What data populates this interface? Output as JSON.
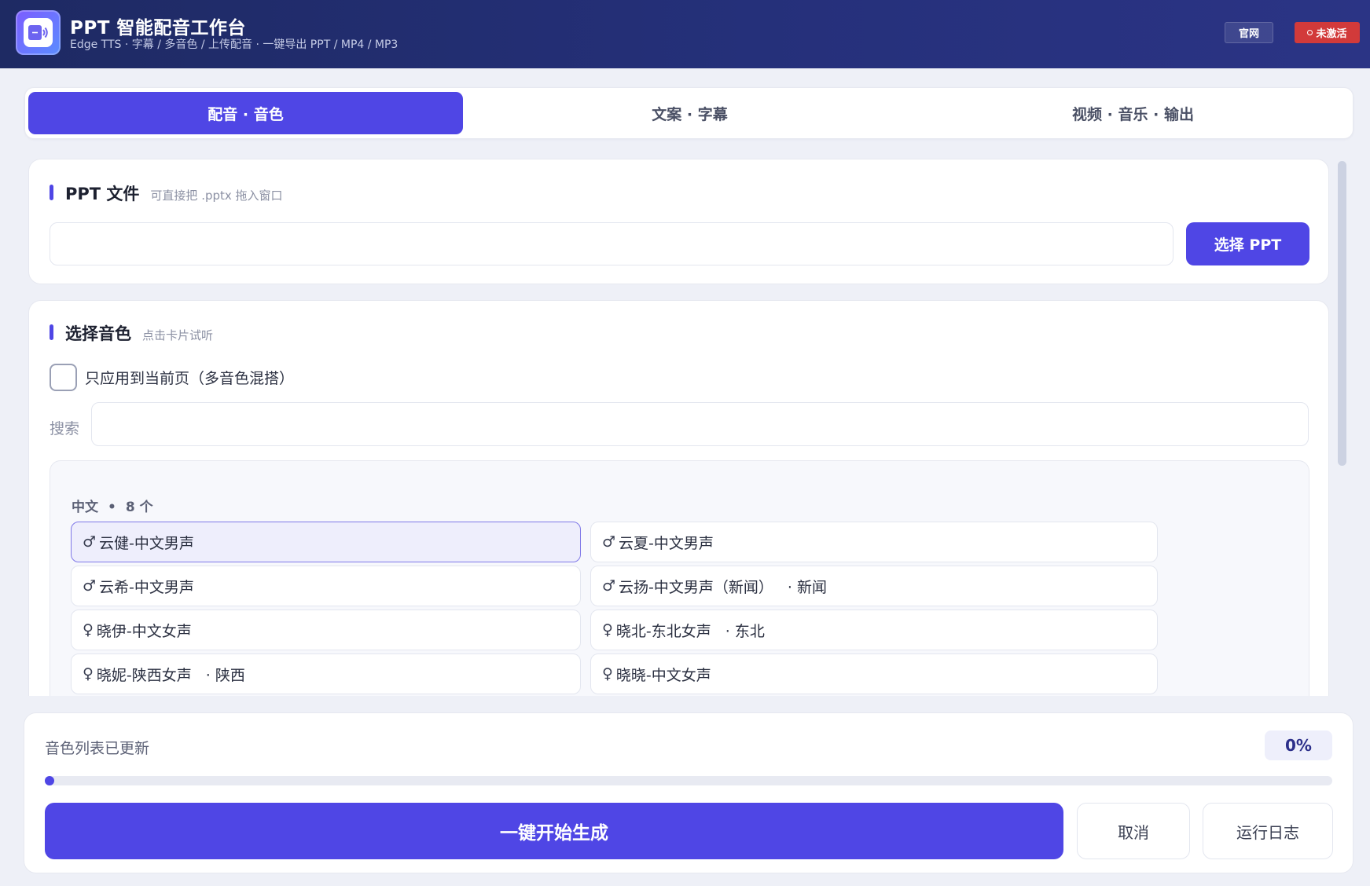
{
  "app": {
    "title": "PPT 智能配音工作台",
    "subtitle": "Edge TTS · 字幕 / 多音色 / 上传配音 · 一键导出 PPT / MP4 / MP3",
    "site_label": "官网",
    "license_label": "未激活"
  },
  "colors": {
    "accent": "#4f46e5",
    "header": "#25307a",
    "danger": "#d23a3a"
  },
  "tabs": [
    {
      "label": "配音 · 音色",
      "active": true
    },
    {
      "label": "文案 · 字幕",
      "active": false
    },
    {
      "label": "视频 · 音乐 · 输出",
      "active": false
    }
  ],
  "ppt_section": {
    "title": "PPT 文件",
    "hint": "可直接把 .pptx 拖入窗口",
    "file_value": "",
    "choose_label": "选择 PPT"
  },
  "voice_section": {
    "title": "选择音色",
    "hint": "点击卡片试听",
    "current_page_only_label": "只应用到当前页（多音色混搭）",
    "current_page_only_checked": false,
    "search_label": "搜索",
    "search_value": "",
    "group": {
      "name": "中文",
      "separator": "•",
      "count": "8 个"
    },
    "voices": [
      {
        "gender": "♂",
        "name": "云健-中文男声",
        "region": "",
        "selected": true
      },
      {
        "gender": "♂",
        "name": "云夏-中文男声",
        "region": "",
        "selected": false
      },
      {
        "gender": "♂",
        "name": "云希-中文男声",
        "region": "",
        "selected": false
      },
      {
        "gender": "♂",
        "name": "云扬-中文男声（新闻）",
        "region": "· 新闻",
        "selected": false
      },
      {
        "gender": "♀",
        "name": "晓伊-中文女声",
        "region": "",
        "selected": false
      },
      {
        "gender": "♀",
        "name": "晓北-东北女声",
        "region": "· 东北",
        "selected": false
      },
      {
        "gender": "♀",
        "name": "晓妮-陕西女声",
        "region": "· 陕西",
        "selected": false
      },
      {
        "gender": "♀",
        "name": "晓晓-中文女声",
        "region": "",
        "selected": false
      }
    ]
  },
  "footer": {
    "status": "音色列表已更新",
    "progress_value": 0,
    "progress_label": "0%",
    "start_label": "一键开始生成",
    "cancel_label": "取消",
    "log_label": "运行日志"
  }
}
